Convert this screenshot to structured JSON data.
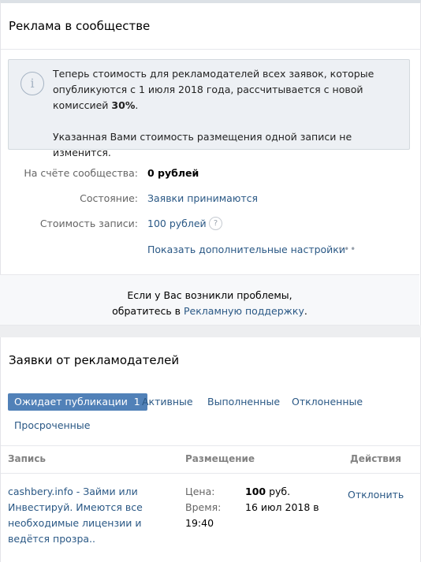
{
  "ads_section": {
    "title": "Реклама в сообществе",
    "notice": {
      "icon": "info-icon",
      "line1_text": "Теперь стоимость для рекламодателей всех заявок, которые опубликуются с 1 июля 2018 года, рассчитывается с новой комиссией ",
      "line1_bold": "30%",
      "line1_end": ".",
      "line2": "Указанная Вами стоимость размещения одной записи не изменится."
    },
    "balance_label": "На счёте сообщества:",
    "balance_value": "0 рублей",
    "status_label": "Состояние:",
    "status_value": "Заявки принимаются",
    "price_label": "Стоимость записи:",
    "price_value": "100 рублей",
    "help_icon": "?",
    "more_settings": "Показать дополнительные настройки",
    "more_icon": "•••",
    "support_line1": "Если у Вас возникли проблемы,",
    "support_line2_prefix": "обратитесь в ",
    "support_link": "Рекламную поддержку",
    "support_line2_suffix": "."
  },
  "requests_section": {
    "title": "Заявки от рекламодателей",
    "tabs": [
      {
        "label": "Ожидает публикации",
        "count": "1",
        "active": true
      },
      {
        "label": "Активные"
      },
      {
        "label": "Выполненные"
      },
      {
        "label": "Отклоненные"
      },
      {
        "label": "Просроченные"
      }
    ],
    "columns": [
      "Запись",
      "Размещение",
      "Действия"
    ],
    "rows": [
      {
        "post_text": "cashbery.info - Займи или Инвестируй. Имеются все необходимые лицензии и ведётся прозра..",
        "price_label": "Цена:",
        "price_value": "100",
        "price_unit": " руб.",
        "time_label": "Время:",
        "time_value_part1": "16 июл 2018 в",
        "time_value_part2": "19:40",
        "action": "Отклонить"
      }
    ]
  }
}
